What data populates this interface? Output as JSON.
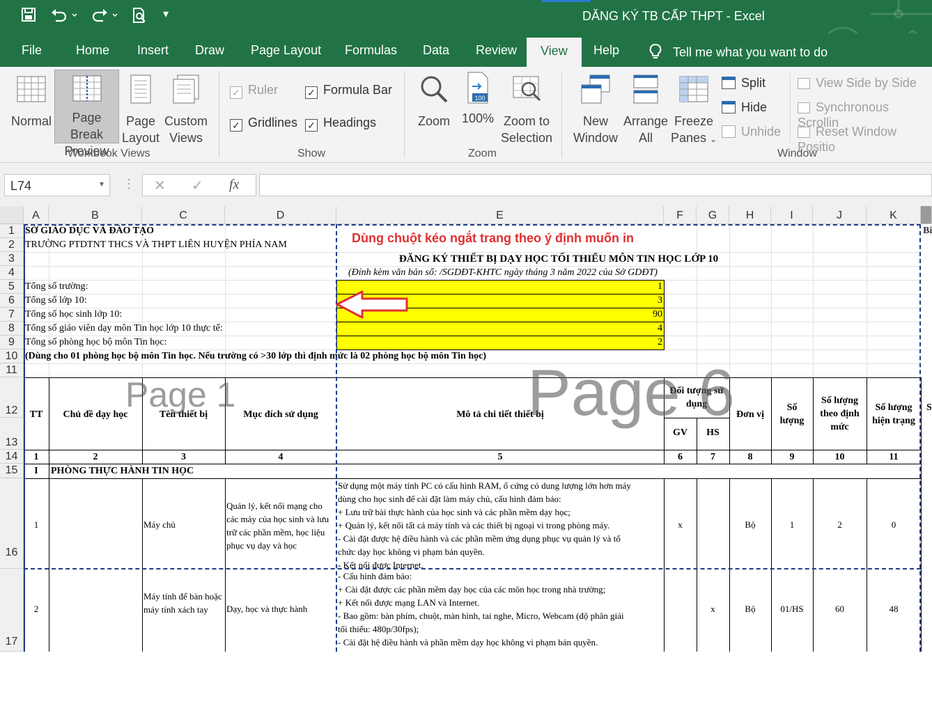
{
  "app": {
    "title": "DĂNG KÝ TB CẤP THPT  -  Excel"
  },
  "quick_access": {
    "save_icon": "save-icon",
    "undo_icon": "undo-icon",
    "redo_icon": "redo-icon",
    "preview_icon": "print-preview-icon",
    "customize_icon": "customize-quick-access-icon"
  },
  "tabs": [
    "File",
    "Home",
    "Insert",
    "Draw",
    "Page Layout",
    "Formulas",
    "Data",
    "Review",
    "View",
    "Help"
  ],
  "active_tab": "View",
  "tell_me": "Tell me what you want to do",
  "ribbon": {
    "workbook_views": {
      "label": "Workbook Views",
      "normal": "Normal",
      "page_break_1": "Page Break",
      "page_break_2": "Preview",
      "page_1": "Page",
      "page_2": "Layout",
      "custom_1": "Custom",
      "custom_2": "Views"
    },
    "show": {
      "label": "Show",
      "ruler": "Ruler",
      "formula_bar": "Formula Bar",
      "gridlines": "Gridlines",
      "headings": "Headings"
    },
    "zoom": {
      "label": "Zoom",
      "zoom": "Zoom",
      "hundred": "100%",
      "badge": "100",
      "zoom_sel_1": "Zoom to",
      "zoom_sel_2": "Selection"
    },
    "window": {
      "label": "Window",
      "new_1": "New",
      "new_2": "Window",
      "arrange_1": "Arrange",
      "arrange_2": "All",
      "freeze_1": "Freeze",
      "freeze_2": "Panes",
      "split": "Split",
      "hide": "Hide",
      "unhide": "Unhide",
      "side_by_side": "View Side by Side",
      "sync_scroll": "Synchronous Scrollin",
      "reset_pos": "Reset Window Positio"
    }
  },
  "formula_bar": {
    "name_box": "L74",
    "fx": "fx",
    "cancel": "✕",
    "enter": "✓"
  },
  "columns": [
    "A",
    "B",
    "C",
    "D",
    "E",
    "F",
    "G",
    "H",
    "I",
    "J",
    "K"
  ],
  "rows": [
    "1",
    "2",
    "3",
    "4",
    "5",
    "6",
    "7",
    "8",
    "9",
    "10",
    "11",
    "12",
    "13",
    "14",
    "15",
    "16",
    "17"
  ],
  "sheet": {
    "r1": "SỞ GIÁO DỤC VÀ ĐÀO TẠO",
    "r2": "TRƯỜNG PTDTNT THCS VÀ THPT LIÊN HUYỆN PHÍA NAM",
    "note": "Dùng chuột kéo ngắt trang theo ý định muốn in",
    "r3": "ĐĂNG KÝ THIẾT BỊ DẠY HỌC TỐI THIỂU MÔN TIN HỌC LỚP 10",
    "r4": "(Đính kèm văn bản số:                    /SGDĐT-KHTC ngày        tháng 3 năm 2022 của Sở GDĐT)",
    "stats": [
      {
        "label": "Tổng số trường:",
        "value": "1"
      },
      {
        "label": "Tổng số lớp 10:",
        "value": "3"
      },
      {
        "label": "Tổng số học sinh lớp 10:",
        "value": "90"
      },
      {
        "label": "Tổng số giáo viên dạy môn Tin học lớp 10 thực tế:",
        "value": "4"
      },
      {
        "label": "Tổng số phòng học bộ môn Tin học:",
        "value": "2"
      }
    ],
    "r10": "(Dùng cho 01 phòng học bộ môn Tin học. Nếu trường có >30 lớp thì định mức là 02 phòng học bộ môn Tin học)",
    "headers": {
      "tt": "TT",
      "chu_de": "Chủ đề dạy học",
      "ten_tb": "Tên thiết bị",
      "muc_dich": "Mục đích sử dụng",
      "mo_ta": "Mô tả chi tiết thiết bị",
      "doi_tuong": "Đối tượng sử dụng",
      "gv": "GV",
      "hs": "HS",
      "don_vi": "Đơn vị",
      "so_luong": "Số lượng",
      "dinh_muc": "Số lượng theo định mức",
      "hien_trang": "Số lượng hiện trạng",
      "l_partial": "S"
    },
    "col_numbers": [
      "1",
      "2",
      "3",
      "4",
      "5",
      "6",
      "7",
      "8",
      "9",
      "10",
      "11"
    ],
    "section": {
      "num": "I",
      "title": "PHÒNG THỰC HÀNH TIN HỌC"
    },
    "item1": {
      "tt": "1",
      "ten": "Máy chủ",
      "muc_dich": "Quản lý, kết nối mạng cho các máy của học sinh và lưu trữ các phần mềm, học liệu phục vụ dạy và học",
      "mo_ta": [
        "Sử dụng một máy tính PC có cấu hình RAM, ổ cứng có dung lượng lớn hơn máy",
        "dùng cho học sinh để cài đặt làm máy chủ, cấu hình đảm bảo:",
        "+ Lưu trữ bài thực hành của học sinh và các phần mềm dạy học;",
        "+ Quản lý, kết nối tất cả máy tính và các thiết bị ngoại vi trong phòng máy.",
        "- Cài đặt được hệ điều hành và các phần mềm ứng dụng phục vụ quản lý và tổ",
        "chức dạy học không vi phạm bản quyền.",
        "- Kết nối được Internet."
      ],
      "gv": "x",
      "hs": "",
      "don_vi": "Bộ",
      "so_luong": "1",
      "dinh_muc": "2",
      "hien_trang": "0"
    },
    "item2": {
      "tt": "2",
      "ten": "Máy tính để bàn hoặc máy tính xách tay",
      "muc_dich": "Dạy, học và thực hành",
      "mo_ta": [
        "- Cấu hình đảm bảo:",
        "+ Cài đặt được các phần mềm dạy học của các môn học trong nhà trường;",
        "+ Kết nối được mạng LAN và Internet.",
        "- Bao gồm: bàn phím, chuột, màn hình, tai nghe, Micro, Webcam (độ phân giải",
        "tối thiểu: 480p/30fps);",
        "- Cài đặt hệ điều hành và phần mềm dạy học không vi phạm bản quyền."
      ],
      "gv": "",
      "hs": "x",
      "don_vi": "Bộ",
      "so_luong": "01/HS",
      "dinh_muc": "60",
      "hien_trang": "48"
    },
    "right_partial": "Bi",
    "page1": "Page 1",
    "page6": "Page 6"
  },
  "colors": {
    "excel_green": "#217346",
    "highlight": "#ffff00",
    "note_red": "#e03030",
    "page_break": "#1f3d8a"
  }
}
